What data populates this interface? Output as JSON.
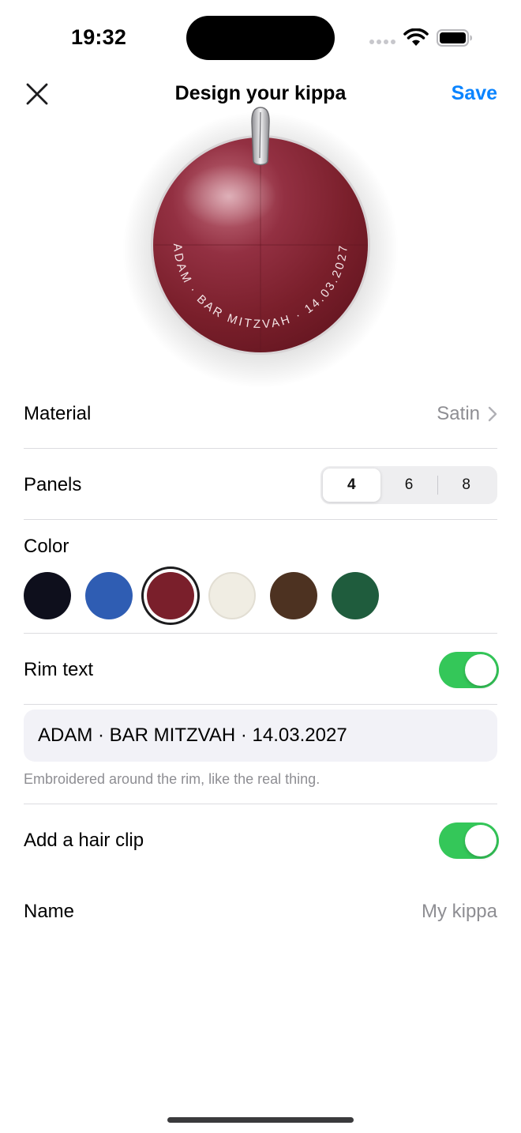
{
  "status": {
    "time": "19:32"
  },
  "nav": {
    "title": "Design your kippa",
    "save_label": "Save",
    "close_icon": "close-icon"
  },
  "preview": {
    "rim_text": "ADAM · BAR MITZVAH · 14.03.2027",
    "color": "#7a1f2b",
    "has_clip": true
  },
  "material": {
    "label": "Material",
    "value": "Satin"
  },
  "panels": {
    "label": "Panels",
    "options": [
      "4",
      "6",
      "8"
    ],
    "selected": "4"
  },
  "color": {
    "label": "Color",
    "swatches": [
      {
        "name": "navy",
        "hex": "#0e0f1c"
      },
      {
        "name": "blue",
        "hex": "#2f5db3"
      },
      {
        "name": "burgundy",
        "hex": "#7a1f2b",
        "selected": true
      },
      {
        "name": "cream",
        "hex": "#f0ede3"
      },
      {
        "name": "brown",
        "hex": "#4d3221"
      },
      {
        "name": "green",
        "hex": "#1f5c3d"
      }
    ]
  },
  "rim_text": {
    "label": "Rim text",
    "enabled": true,
    "value": "ADAM · BAR MITZVAH · 14.03.2027",
    "helper": "Embroidered around the rim, like the real thing."
  },
  "hair_clip": {
    "label": "Add a hair clip",
    "enabled": true
  },
  "name": {
    "label": "Name",
    "placeholder": "My kippa"
  }
}
